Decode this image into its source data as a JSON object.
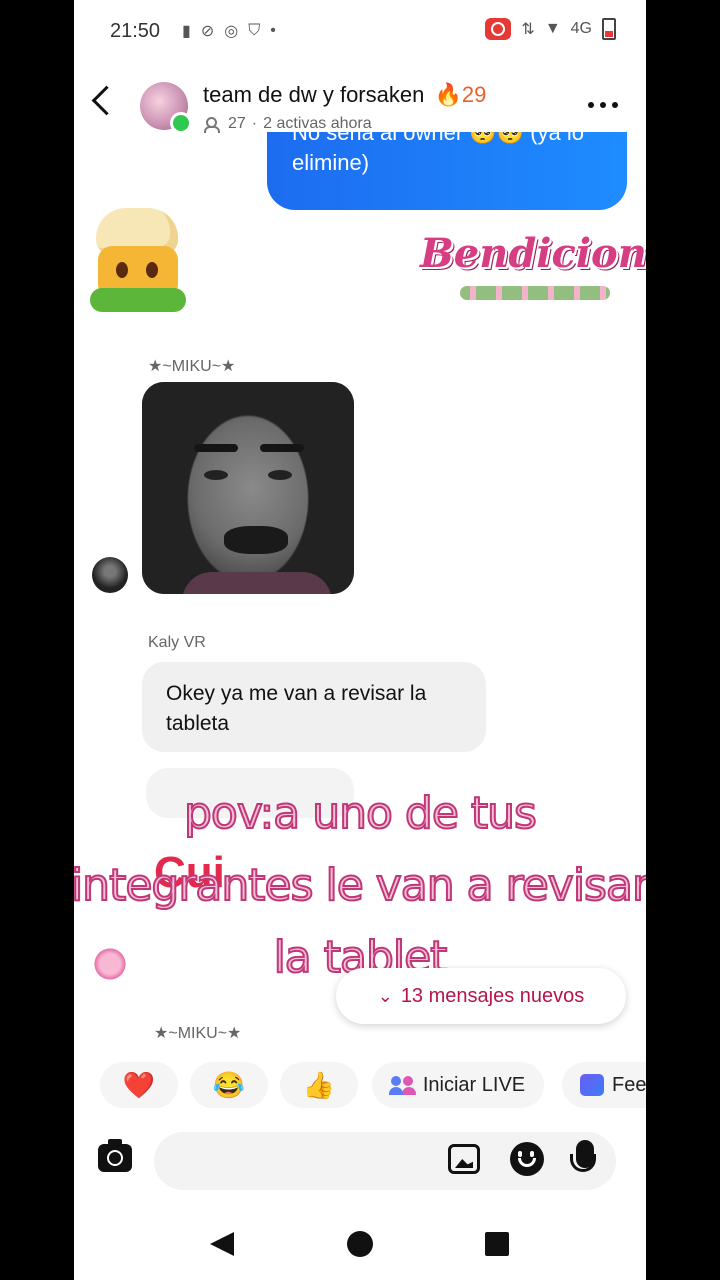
{
  "status_bar": {
    "time": "21:50",
    "network": "4G"
  },
  "header": {
    "title": "team de dw y forsaken",
    "streak_emoji": "🔥",
    "streak_count": "29",
    "members": "27",
    "subtitle_sep": "·",
    "active": "2 activas ahora"
  },
  "messages": {
    "outgoing_text": "No seria al owner 🥺🥺 (ya lo elimine)",
    "sticker_right_text": "Bendiciones",
    "sender_1": "★~MIKU~★",
    "sender_2": "Kaly VR",
    "incoming_text": "Okey ya me van a revisar la tableta",
    "red_sticker_text": "Cui",
    "sender_3": "★~MIKU~★"
  },
  "overlay_caption": {
    "line1": "pov:a uno de tus",
    "line2": "integrantes le van a revisar",
    "line3": "la tablet"
  },
  "new_messages_label": "13 mensajes nuevos",
  "quick_actions": {
    "heart": "❤️",
    "laugh": "😂",
    "thumbs": "👍",
    "live_label": "Iniciar LIVE",
    "feed_label": "Fee"
  },
  "colors": {
    "accent": "#1e7cf5",
    "new_messages": "#b5154b",
    "overlay_text": "#f5bfd7"
  }
}
